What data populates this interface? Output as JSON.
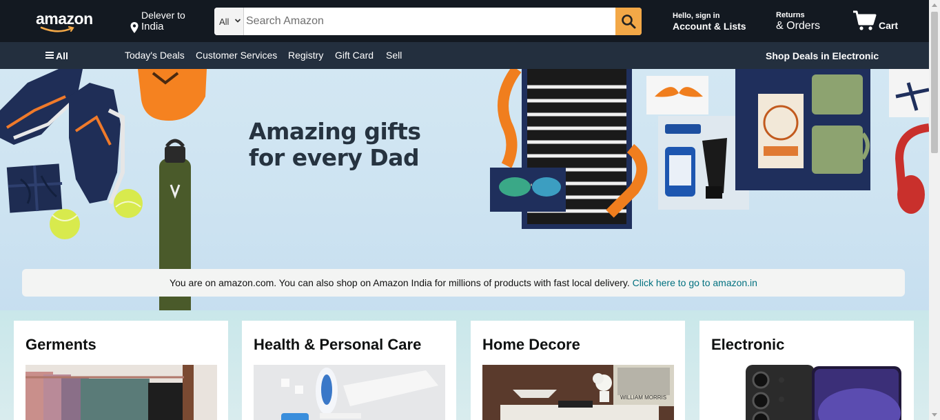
{
  "header": {
    "logo": "amazon",
    "deliver_line1": "Delever to",
    "deliver_line2": "India",
    "search": {
      "category": "All",
      "placeholder": "Search Amazon"
    },
    "account_line1": "Hello, sign in",
    "account_line2": "Account & Lists",
    "orders_line1": "Returns",
    "orders_line2": "& Orders",
    "cart_label": "Cart"
  },
  "subnav": {
    "all_label": "All",
    "items": [
      "Today's Deals",
      "Customer Services",
      "Registry",
      "Gift Card",
      "Sell"
    ],
    "promo": "Shop Deals in Electronic"
  },
  "hero": {
    "title_line1": "Amazing gifts",
    "title_line2": "for every Dad"
  },
  "notice": {
    "text": "You are on amazon.com. You can also shop on Amazon India for millions of products with fast local delivery.",
    "link": "Click here to go to amazon.in"
  },
  "cards": [
    {
      "title": "Germents"
    },
    {
      "title": "Health & Personal Care"
    },
    {
      "title": "Home Decore"
    },
    {
      "title": "Electronic"
    }
  ],
  "colors": {
    "nav_dark": "#131921",
    "subnav": "#232f3e",
    "search_button": "#f3a847",
    "hero_bg": "#d3e7f3",
    "link": "#00707f"
  }
}
